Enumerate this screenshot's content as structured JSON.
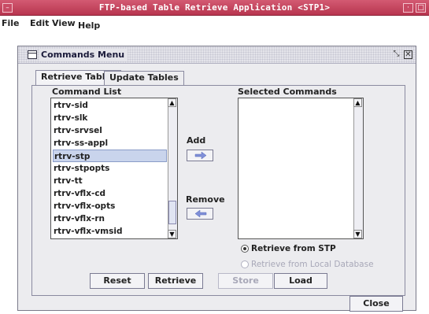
{
  "window": {
    "title": "FTP-based Table Retrieve Application <STP1>"
  },
  "menubar": {
    "items": [
      "File",
      "Edit",
      "View",
      "Help"
    ]
  },
  "frame": {
    "title": "Commands Menu"
  },
  "tabs": [
    {
      "label": "Retrieve Tables",
      "active": true
    },
    {
      "label": "Update Tables",
      "active": false
    }
  ],
  "command_list": {
    "label": "Command List",
    "items": [
      "rtrv-sid",
      "rtrv-slk",
      "rtrv-srvsel",
      "rtrv-ss-appl",
      "rtrv-stp",
      "rtrv-stpopts",
      "rtrv-tt",
      "rtrv-vflx-cd",
      "rtrv-vflx-opts",
      "rtrv-vflx-rn",
      "rtrv-vflx-vmsid"
    ],
    "selected": "rtrv-stp"
  },
  "selected_commands": {
    "label": "Selected Commands",
    "items": []
  },
  "actions": {
    "add_label": "Add",
    "remove_label": "Remove"
  },
  "source_options": [
    {
      "label": "Retrieve from STP",
      "selected": true,
      "enabled": true
    },
    {
      "label": "Retrieve from Local Database",
      "selected": false,
      "enabled": false
    }
  ],
  "buttons": {
    "reset": "Reset",
    "retrieve": "Retrieve",
    "store": "Store",
    "load": "Load",
    "close": "Close"
  },
  "colors": {
    "titlebar": "#c04560",
    "list_selection": "#c9d4ec",
    "arrow": "#7f8fd8"
  }
}
